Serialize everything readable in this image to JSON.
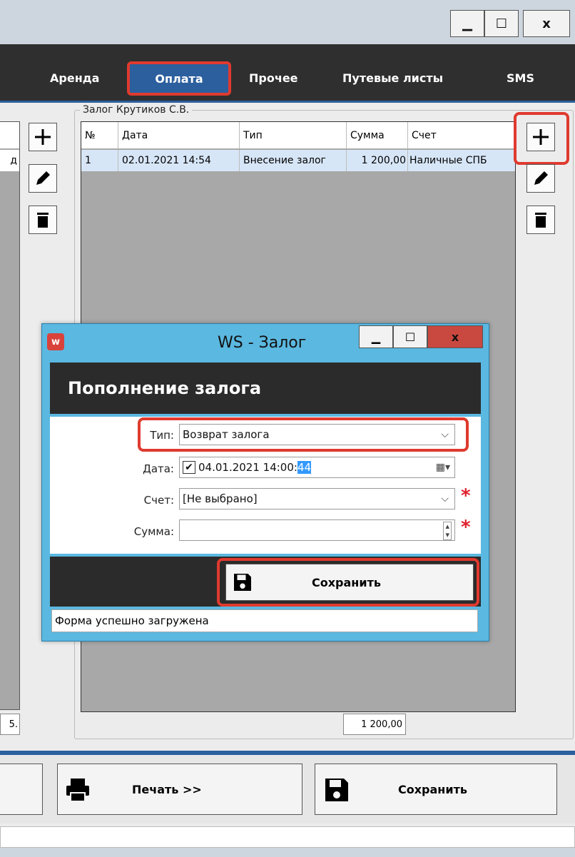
{
  "window": {
    "controls": {
      "minimize": "▁",
      "maximize": "☐",
      "close": "x"
    }
  },
  "nav": {
    "tabs": [
      {
        "label": "Аренда"
      },
      {
        "label": "Оплата",
        "active": true
      },
      {
        "label": "Прочее"
      },
      {
        "label": "Путевые листы"
      },
      {
        "label": "SMS"
      }
    ]
  },
  "left_panel": {
    "cut_header": "д",
    "cut_total": "5."
  },
  "deposit": {
    "group_label": "Залог Крутиков С.В.",
    "columns": [
      "№",
      "Дата",
      "Тип",
      "Сумма",
      "Счет"
    ],
    "rows": [
      {
        "n": "1",
        "date": "02.01.2021 14:54",
        "type": "Внесение залог",
        "sum": "1 200,00",
        "account": "Наличные СПБ"
      }
    ],
    "total": "1 200,00"
  },
  "bottom": {
    "print_label": "Печать  >>",
    "save_label": "Сохранить"
  },
  "dialog": {
    "icon_text": "w",
    "title": "WS - Залог",
    "heading": "Пополнение залога",
    "fields": {
      "type_label": "Тип:",
      "type_value": "Возврат залога",
      "date_label": "Дата:",
      "date_value_main": "04.01.2021 14:00:",
      "date_value_sel": "44",
      "date_checked": true,
      "account_label": "Счет:",
      "account_value": "[Не выбрано]",
      "amount_label": "Сумма:",
      "amount_value": "",
      "required_mark": "*"
    },
    "save_label": "Сохранить",
    "status": "Форма успешно загружена"
  },
  "colors": {
    "accent": "#2c5f9e",
    "highlight": "#e03a2f",
    "dialog_frame": "#5bb8e0",
    "dark": "#2b2b2b"
  }
}
